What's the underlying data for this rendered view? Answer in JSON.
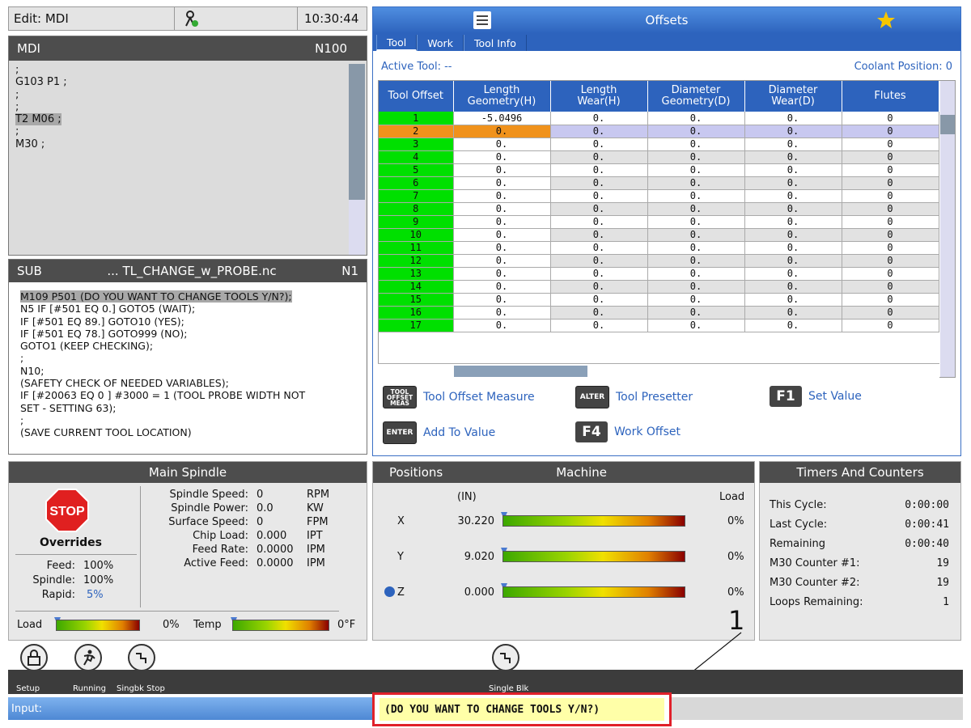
{
  "status": {
    "mode": "Edit: MDI",
    "time": "10:30:44"
  },
  "mdi": {
    "title": "MDI",
    "line_no": "N100",
    "lines": [
      ";",
      "G103 P1 ;",
      ";",
      ";",
      "T2 M06 ;",
      ";",
      "M30 ;"
    ]
  },
  "sub": {
    "title": "SUB",
    "file": "... TL_CHANGE_w_PROBE.nc",
    "line_no": "N1",
    "lines": [
      "M109 P501 (DO YOU WANT TO CHANGE TOOLS Y/N?);",
      "N5 IF [#501 EQ 0.] GOTO5 (WAIT);",
      "IF [#501 EQ 89.] GOTO10 (YES);",
      "IF [#501 EQ 78.] GOTO999 (NO);",
      "GOTO1 (KEEP CHECKING);",
      ";",
      "N10;",
      "(SAFETY CHECK OF NEEDED VARIABLES);",
      "IF [#20063 EQ 0 ] #3000 = 1 (TOOL PROBE WIDTH NOT",
      "SET - SETTING 63);",
      ";",
      "(SAVE CURRENT TOOL LOCATION)"
    ]
  },
  "offsets": {
    "title": "Offsets",
    "tabs": [
      "Tool",
      "Work",
      "Tool Info"
    ],
    "active_tool_label": "Active Tool:  --",
    "coolant_label": "Coolant Position:  0",
    "columns": [
      "Tool Offset",
      "Length\nGeometry(H)",
      "Length\nWear(H)",
      "Diameter\nGeometry(D)",
      "Diameter\nWear(D)",
      "Flutes"
    ],
    "rows": [
      [
        "1",
        "-5.0496",
        "0.",
        "0.",
        "0.",
        "0"
      ],
      [
        "2",
        "0.",
        "0.",
        "0.",
        "0.",
        "0"
      ],
      [
        "3",
        "0.",
        "0.",
        "0.",
        "0.",
        "0"
      ],
      [
        "4",
        "0.",
        "0.",
        "0.",
        "0.",
        "0"
      ],
      [
        "5",
        "0.",
        "0.",
        "0.",
        "0.",
        "0"
      ],
      [
        "6",
        "0.",
        "0.",
        "0.",
        "0.",
        "0"
      ],
      [
        "7",
        "0.",
        "0.",
        "0.",
        "0.",
        "0"
      ],
      [
        "8",
        "0.",
        "0.",
        "0.",
        "0.",
        "0"
      ],
      [
        "9",
        "0.",
        "0.",
        "0.",
        "0.",
        "0"
      ],
      [
        "10",
        "0.",
        "0.",
        "0.",
        "0.",
        "0"
      ],
      [
        "11",
        "0.",
        "0.",
        "0.",
        "0.",
        "0"
      ],
      [
        "12",
        "0.",
        "0.",
        "0.",
        "0.",
        "0"
      ],
      [
        "13",
        "0.",
        "0.",
        "0.",
        "0.",
        "0"
      ],
      [
        "14",
        "0.",
        "0.",
        "0.",
        "0.",
        "0"
      ],
      [
        "15",
        "0.",
        "0.",
        "0.",
        "0.",
        "0"
      ],
      [
        "16",
        "0.",
        "0.",
        "0.",
        "0.",
        "0"
      ],
      [
        "17",
        "0.",
        "0.",
        "0.",
        "0.",
        "0"
      ]
    ],
    "selected_row": 1,
    "actions": {
      "tool_offset_measure": "Tool Offset Measure",
      "tool_offset_key": "TOOL OFFSET MEAS",
      "tool_presetter": "Tool Presetter",
      "alter_key": "ALTER",
      "set_value": "Set Value",
      "f1_key": "F1",
      "add_to_value": "Add To Value",
      "enter_key": "ENTER",
      "work_offset": "Work Offset",
      "f4_key": "F4"
    }
  },
  "spindle": {
    "title": "Main Spindle",
    "stop": "STOP",
    "overrides_label": "Overrides",
    "overrides": [
      {
        "label": "Feed:",
        "value": "100%"
      },
      {
        "label": "Spindle:",
        "value": "100%"
      },
      {
        "label": "Rapid:",
        "value": "5%"
      }
    ],
    "stats": [
      {
        "label": "Spindle Speed:",
        "value": "0",
        "unit": "RPM"
      },
      {
        "label": "Spindle Power:",
        "value": "0.0",
        "unit": "KW"
      },
      {
        "label": "Surface Speed:",
        "value": "0",
        "unit": "FPM"
      },
      {
        "label": "Chip Load:",
        "value": "0.000",
        "unit": "IPT"
      },
      {
        "label": "Feed Rate:",
        "value": "0.0000",
        "unit": "IPM"
      },
      {
        "label": "Active Feed:",
        "value": "0.0000",
        "unit": "IPM"
      }
    ],
    "load_label": "Load",
    "load_value": "0%",
    "temp_label": "Temp",
    "temp_value": "0°F"
  },
  "positions": {
    "title": "Positions",
    "mode": "Machine",
    "unit": "(IN)",
    "load_header": "Load",
    "axes": [
      {
        "axis": "X",
        "value": "30.220",
        "load": "0%"
      },
      {
        "axis": "Y",
        "value": "9.020",
        "load": "0%"
      },
      {
        "axis": "Z",
        "value": "0.000",
        "load": "0%"
      }
    ]
  },
  "timers": {
    "title": "Timers And Counters",
    "items": [
      {
        "label": "This Cycle:",
        "value": "0:00:00"
      },
      {
        "label": "Last Cycle:",
        "value": "0:00:41"
      },
      {
        "label": "Remaining",
        "value": "0:00:40"
      },
      {
        "label": "M30 Counter #1:",
        "value": "19"
      },
      {
        "label": "M30 Counter #2:",
        "value": "19"
      },
      {
        "label": "Loops Remaining:",
        "value": "1"
      }
    ]
  },
  "icons": {
    "setup": "Setup",
    "running": "Running",
    "singbk_stop": "Singbk Stop",
    "single_blk": "Single Blk"
  },
  "input": {
    "label": "Input:"
  },
  "message": "(DO YOU WANT TO CHANGE TOOLS Y/N?)",
  "callout": "1"
}
